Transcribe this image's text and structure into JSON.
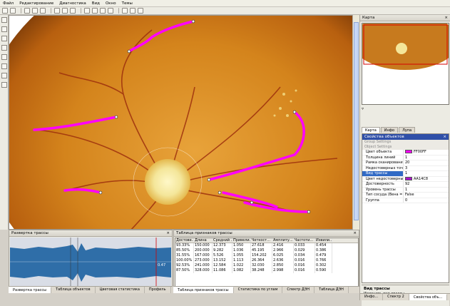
{
  "menu": [
    "Файл",
    "Редактирование",
    "Диагностика",
    "Вид",
    "Окно",
    "Темы"
  ],
  "map_panel": {
    "title": "Карта",
    "tabs": [
      "Карта",
      "Инфо",
      "Лупа"
    ],
    "active_tab": "Карта"
  },
  "props_panel": {
    "title": "Свойства объектов",
    "groups": [
      "Group Settings",
      "Object Settings"
    ],
    "rows": [
      {
        "key": "Цвет объекта",
        "value": "FF00FF",
        "swatch": "#ff00ff"
      },
      {
        "key": "Толщина линий",
        "value": "1"
      },
      {
        "key": "Рамка сканирования",
        "value": "20"
      },
      {
        "key": "Недостоверных точек",
        "value": "3"
      },
      {
        "key": "Вид трассы",
        "value": "1",
        "selected": true
      },
      {
        "key": "Цвет недостоверных",
        "value": "AA14C8",
        "swatch": "#aa14c8"
      },
      {
        "key": "Достоверность",
        "value": "92"
      },
      {
        "key": "Уровень трассы",
        "value": "1"
      },
      {
        "key": "Тип сосуда (Вена = 1)",
        "value": "False"
      },
      {
        "key": "Группа",
        "value": "0"
      }
    ],
    "desc_title": "Вид трассы",
    "desc_text": "Изменить вид трассы"
  },
  "right_bottom_tabs": [
    "Инфо...",
    "Спектр 2",
    "Свойства объ..."
  ],
  "trace_panel": {
    "title": "Развертка трассы",
    "marker_value": "0.47",
    "tabs": [
      "Развертка трассы",
      "Таблица объектов",
      "Цветовая статистика",
      "Профиль"
    ]
  },
  "table_panel": {
    "title": "Таблица признаков трассы",
    "columns": [
      "Достове...",
      "Длина",
      "Средний ...",
      "Привели...",
      "Четкост...",
      "Амплиту...",
      "Частоти...",
      "Извили..."
    ],
    "rows": [
      [
        "93.33%",
        "150.000",
        "12.373",
        "1.050",
        "27.618",
        "2.416",
        "0.033",
        "0.454"
      ],
      [
        "85.50%",
        "200.000",
        "9.282",
        "1.036",
        "45.195",
        "2.966",
        "0.029",
        "0.386"
      ],
      [
        "31.55%",
        "167.000",
        "5.526",
        "1.055",
        "154.202",
        "6.025",
        "0.034",
        "0.479"
      ],
      [
        "100.00%",
        "273.000",
        "13.152",
        "1.113",
        "26.364",
        "2.636",
        "0.016",
        "0.766"
      ],
      [
        "92.53%",
        "241.000",
        "12.584",
        "1.022",
        "32.030",
        "2.850",
        "0.016",
        "0.302"
      ],
      [
        "87.50%",
        "328.000",
        "11.086",
        "1.082",
        "38.248",
        "2.998",
        "0.016",
        "0.590"
      ]
    ],
    "tabs": [
      "Таблица признаков трассы",
      "Статистика по углам",
      "Спектр ДЭН",
      "Таблица ДЭН"
    ]
  },
  "colors": {
    "trace_color": "#ff00ff",
    "uncertain_color": "#aa14c8",
    "selected_row": "#316ac5",
    "fundus_orange": "#d88a1e"
  }
}
